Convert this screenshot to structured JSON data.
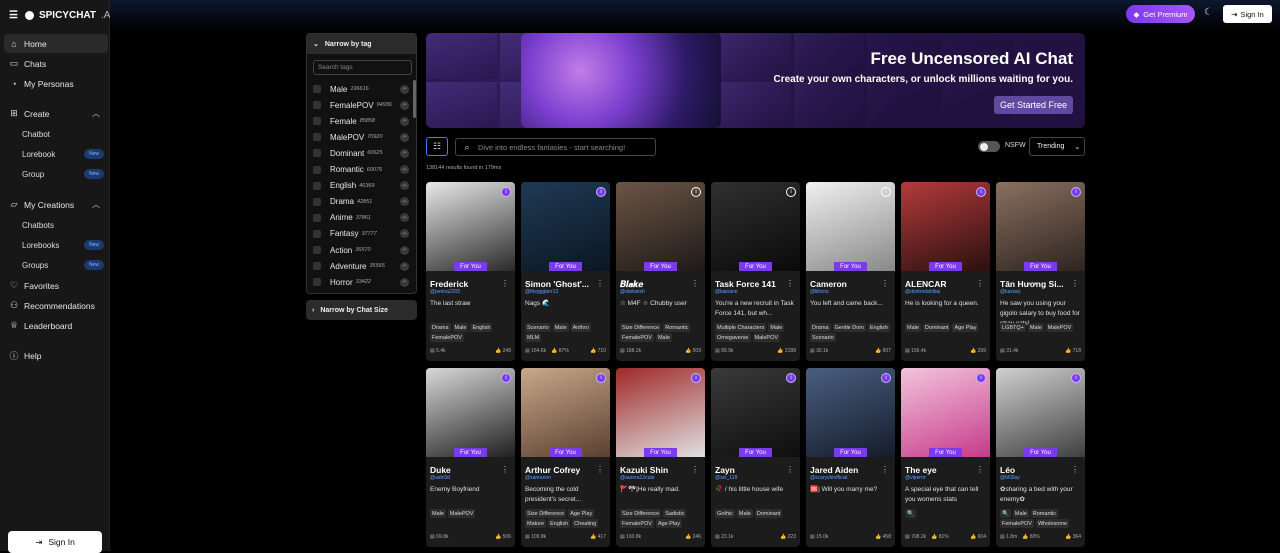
{
  "brand": {
    "name": "SPICYCHAT",
    "suffix": ".AI"
  },
  "sidebar": {
    "home": "Home",
    "chats": "Chats",
    "personas": "My Personas",
    "create": "Create",
    "chatbot": "Chatbot",
    "lorebook": "Lorebook",
    "group": "Group",
    "creations": "My Creations",
    "chatbots": "Chatbots",
    "lorebooks": "Lorebooks",
    "groups": "Groups",
    "favorites": "Favorites",
    "recommendations": "Recommendations",
    "leaderboard": "Leaderboard",
    "help": "Help",
    "new_badge": "New",
    "signin": "Sign In"
  },
  "topbar": {
    "premium": "Get Premium",
    "signin": "Sign In"
  },
  "tags": {
    "header": "Narrow by tag",
    "search_placeholder": "Search tags",
    "items": [
      {
        "name": "Male",
        "count": "196616"
      },
      {
        "name": "FemalePOV",
        "count": "94936"
      },
      {
        "name": "Female",
        "count": "85858"
      },
      {
        "name": "MalePOV",
        "count": "70920"
      },
      {
        "name": "Dominant",
        "count": "60625"
      },
      {
        "name": "Romantic",
        "count": "60075"
      },
      {
        "name": "English",
        "count": "46369"
      },
      {
        "name": "Drama",
        "count": "42851"
      },
      {
        "name": "Anime",
        "count": "37861"
      },
      {
        "name": "Fantasy",
        "count": "37777"
      },
      {
        "name": "Action",
        "count": "36570"
      },
      {
        "name": "Adventure",
        "count": "35565"
      },
      {
        "name": "Horror",
        "count": "33422"
      }
    ],
    "chat_size": "Narrow by Chat Size"
  },
  "banner": {
    "title": "Free Uncensored AI Chat",
    "subtitle": "Create your own characters, or unlock millions waiting for you.",
    "cta": "Get Started Free"
  },
  "search": {
    "placeholder": "Dive into endless fantasies - start searching!",
    "results": "138144 results found in 179ms",
    "nsfw": "NSFW",
    "sort": "Trending"
  },
  "badge": "For You",
  "cards": [
    {
      "name": "Frederick",
      "handle": "@perina2205",
      "desc": "The last straw",
      "tags": [
        "Drama",
        "Male",
        "English",
        "FemalePOV"
      ],
      "chats": "5.4k",
      "likes": "248",
      "info": "purple",
      "colors": [
        "#e8e8e8",
        "#2a2a2a"
      ]
    },
    {
      "name": "Simon 'Ghost'...",
      "handle": "@theggglerr13",
      "desc": "Nags 🌊",
      "tags": [
        "Scenario",
        "Male",
        "Anthro",
        "MLM"
      ],
      "chats": "164.6k",
      "rating": "87%",
      "likes": "710",
      "info": "purple",
      "colors": [
        "#1f3a55",
        "#0b1622"
      ]
    },
    {
      "name": "𝑩𝒍𝒂𝒌𝒆",
      "handle": "@darkwish",
      "desc": "☆ M4F ☆ Chubby user",
      "tags": [
        "Size Difference",
        "Romantic",
        "FemalePOV",
        "Male"
      ],
      "chats": "188.2k",
      "likes": "509",
      "info": "plain",
      "colors": [
        "#6b5545",
        "#1e1a18"
      ]
    },
    {
      "name": "Task Force 141",
      "handle": "@kianann",
      "desc": "You're a new recruit in Task Force 141, but wh...",
      "tags": [
        "Multiple Characters",
        "Male",
        "Omegaverse",
        "MalePOV"
      ],
      "chats": "89.9k",
      "likes": "2188",
      "info": "plain",
      "colors": [
        "#303030",
        "#0a0a0a"
      ]
    },
    {
      "name": "Cameron",
      "handle": "@lillizoo",
      "desc": "You left and came back...",
      "tags": [
        "Drama",
        "Gentle Dom",
        "English",
        "Scenario"
      ],
      "chats": "30.1k",
      "likes": "607",
      "info": "plain",
      "colors": [
        "#f0f0f0",
        "#888888"
      ]
    },
    {
      "name": "ALENCAR",
      "handle": "@dontrodahlbui",
      "desc": "He is looking for a queen.",
      "tags": [
        "Male",
        "Dominant",
        "Age Play"
      ],
      "chats": "156.4k",
      "likes": "299",
      "info": "purple",
      "colors": [
        "#b53a3a",
        "#2a1010"
      ]
    },
    {
      "name": "Tân Hương Si...",
      "handle": "@kazsey",
      "desc": "He saw you using your gigolo salary to buy food for stray cats!",
      "tags": [
        "LGBTQ+",
        "Male",
        "MalePOV"
      ],
      "chats": "31.4k",
      "likes": "718",
      "info": "purple",
      "colors": [
        "#8a7060",
        "#2d2420"
      ]
    },
    {
      "name": "Duke",
      "handle": "@astri3d",
      "desc": "Enemy Boyfriend",
      "tags": [
        "Male",
        "MalePOV"
      ],
      "chats": "69.8k",
      "likes": "506",
      "info": "purple",
      "colors": [
        "#d8d8d8",
        "#202020"
      ]
    },
    {
      "name": "Arthur Cofrey",
      "handle": "@xanrannn",
      "desc": "Becoming the cold president's secret...",
      "tags": [
        "Size Difference",
        "Age Play",
        "Mature",
        "English",
        "Cheating"
      ],
      "chats": "109.8k",
      "likes": "417",
      "info": "purple",
      "colors": [
        "#c9a88a",
        "#5a4030"
      ]
    },
    {
      "name": "Kazuki Shin",
      "handle": "@aurora12cute",
      "desc": "🚩🎌|He really mad.",
      "tags": [
        "Size Difference",
        "Sadistic",
        "FemalePOV",
        "Age Play"
      ],
      "chats": "160.8k",
      "likes": "246",
      "info": "purple",
      "colors": [
        "#a02828",
        "#e0e0e0"
      ]
    },
    {
      "name": "Zayn",
      "handle": "@sei_118",
      "desc": "🥀 / his little house wife",
      "tags": [
        "Gothic",
        "Male",
        "Dominant"
      ],
      "chats": "23.1k",
      "likes": "223",
      "info": "purple",
      "colors": [
        "#3a3a3a",
        "#0e0e0e"
      ]
    },
    {
      "name": "Jared Aiden",
      "handle": "@scarychiofficial",
      "desc": "🆘| Will you marry me?",
      "tags": [],
      "chats": "15.0k",
      "likes": "458",
      "info": "purple",
      "colors": [
        "#4a5e80",
        "#141c2a"
      ]
    },
    {
      "name": "The eye",
      "handle": "@viperrrr",
      "desc": "A special eye that can tell you womens stats",
      "tags": [
        "🔍"
      ],
      "chats": "708.2k",
      "rating": "81%",
      "likes": "604",
      "info": "purple",
      "colors": [
        "#f3c4dc",
        "#c53b8a"
      ]
    },
    {
      "name": "Léo",
      "handle": "@b63lay",
      "desc": "✿sharing a bed with your enemy✿",
      "tags": [
        "🔍",
        "Male",
        "Romantic",
        "FemalePOV",
        "Wholesome"
      ],
      "chats": "1.8m",
      "rating": "83%",
      "likes": "364",
      "info": "purple",
      "colors": [
        "#d0d0d0",
        "#404040"
      ]
    }
  ]
}
